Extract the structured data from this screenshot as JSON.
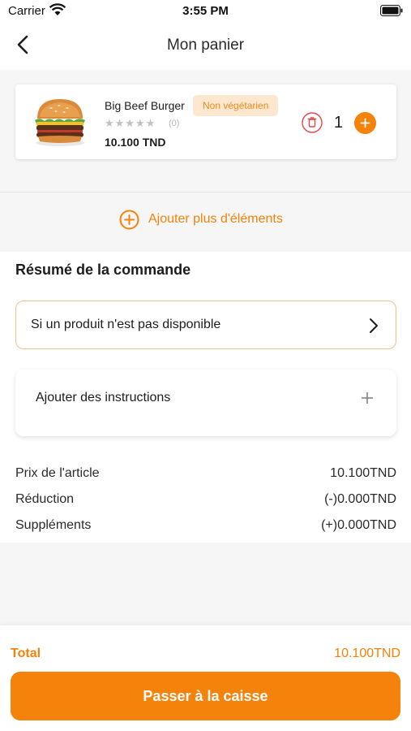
{
  "status_bar": {
    "carrier": "Carrier",
    "time": "3:55 PM"
  },
  "header": {
    "title": "Mon panier",
    "back_icon": "chevron-left-icon"
  },
  "cart": {
    "items": [
      {
        "name": "Big Beef Burger",
        "badge": "Non végétarien",
        "rating": 0,
        "stars": "★★★★★",
        "review_count": "(0)",
        "price": "10.100 TND",
        "quantity": "1",
        "image": "burger-image"
      }
    ]
  },
  "add_more": {
    "label": "Ajouter plus d'éléments",
    "icon": "plus-circle-icon"
  },
  "summary": {
    "title": "Résumé de la commande",
    "unavailable_option": "Si un produit n'est pas disponible",
    "instructions": "Ajouter des instructions",
    "lines": [
      {
        "label": "Prix de l'article",
        "value": "10.100TND"
      },
      {
        "label": "Réduction",
        "value": "(-)0.000TND"
      },
      {
        "label": "Suppléments",
        "value": "(+)0.000TND"
      }
    ]
  },
  "footer": {
    "total_label": "Total",
    "total_value": "10.100TND",
    "checkout_label": "Passer à la caisse"
  },
  "colors": {
    "accent": "#f5820a",
    "badge_bg": "#fde8cf",
    "delete": "#e2474a",
    "section_bg": "#f6f6f6"
  }
}
